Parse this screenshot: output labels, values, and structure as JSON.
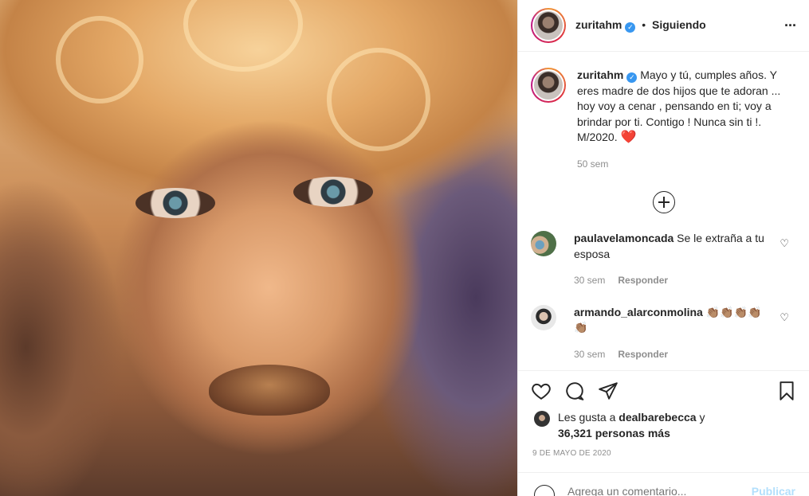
{
  "post": {
    "image_alt": "Retrato de mujer rubia con cabello rizado",
    "author": "zuritahm",
    "follow_status": "Siguiendo",
    "dot": "•",
    "more_icon": "···"
  },
  "caption": {
    "author": "zuritahm",
    "text": "Mayo y tú, cumples años. Y eres madre de dos hijos que te adoran ... hoy voy a cenar , pensando en ti; voy a brindar por ti. Contigo ! Nunca sin ti !. M/2020.",
    "heart": "❤️",
    "time": "50 sem"
  },
  "comments": [
    {
      "user": "paulavelamoncada",
      "text": "Se le extraña a tu esposa",
      "time": "30 sem",
      "reply": "Responder"
    },
    {
      "user": "armando_alarconmolina",
      "text": "👏🏽👏🏽👏🏽👏🏽👏🏽",
      "time": "30 sem",
      "reply": "Responder"
    }
  ],
  "likes": {
    "prefix": "Les gusta a",
    "user": "dealbarebecca",
    "and": "y",
    "count": "36,321 personas más"
  },
  "date": "9 DE MAYO DE 2020",
  "add_comment": {
    "placeholder": "Agrega un comentario...",
    "publish": "Publicar"
  },
  "colors": {
    "accent": "#3897f0",
    "publish_disabled": "#b2dffc",
    "heart": "#e0245e"
  }
}
